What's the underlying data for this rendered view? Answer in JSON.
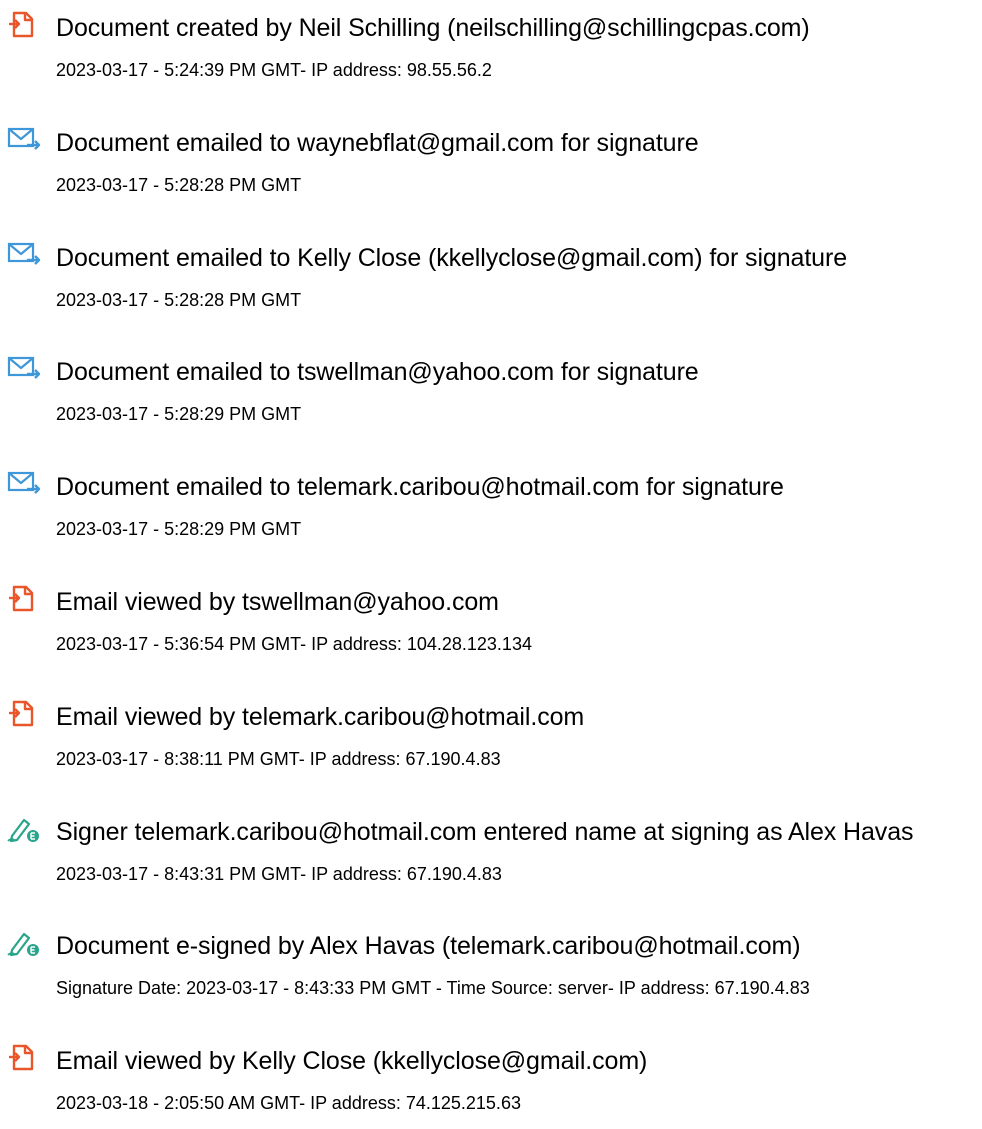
{
  "colors": {
    "document_icon": "#e8562a",
    "email_icon": "#3e97d8",
    "signature_icon": "#2aa48a",
    "text": "#000000"
  },
  "events": [
    {
      "icon": "document-icon",
      "title": "Document created by Neil Schilling (neilschilling@schillingcpas.com)",
      "meta": "2023-03-17 - 5:24:39 PM GMT- IP address: 98.55.56.2"
    },
    {
      "icon": "email-send-icon",
      "title": "Document emailed to waynebflat@gmail.com for signature",
      "meta": "2023-03-17 - 5:28:28 PM GMT"
    },
    {
      "icon": "email-send-icon",
      "title": "Document emailed to Kelly Close (kkellyclose@gmail.com) for signature",
      "meta": "2023-03-17 - 5:28:28 PM GMT"
    },
    {
      "icon": "email-send-icon",
      "title": "Document emailed to tswellman@yahoo.com for signature",
      "meta": "2023-03-17 - 5:28:29 PM GMT"
    },
    {
      "icon": "email-send-icon",
      "title": "Document emailed to telemark.caribou@hotmail.com for signature",
      "meta": "2023-03-17 - 5:28:29 PM GMT"
    },
    {
      "icon": "document-icon",
      "title": "Email viewed by tswellman@yahoo.com",
      "meta": "2023-03-17 - 5:36:54 PM GMT- IP address: 104.28.123.134"
    },
    {
      "icon": "document-icon",
      "title": "Email viewed by telemark.caribou@hotmail.com",
      "meta": "2023-03-17 - 8:38:11 PM GMT- IP address: 67.190.4.83"
    },
    {
      "icon": "signature-pen-icon",
      "title": "Signer telemark.caribou@hotmail.com entered name at signing as Alex Havas",
      "meta": "2023-03-17 - 8:43:31 PM GMT- IP address: 67.190.4.83"
    },
    {
      "icon": "signature-pen-icon",
      "title": "Document e-signed by Alex Havas (telemark.caribou@hotmail.com)",
      "meta": "Signature Date: 2023-03-17 - 8:43:33 PM GMT - Time Source: server- IP address: 67.190.4.83"
    },
    {
      "icon": "document-icon",
      "title": "Email viewed by Kelly Close (kkellyclose@gmail.com)",
      "meta": "2023-03-18 - 2:05:50 AM GMT- IP address: 74.125.215.63"
    }
  ]
}
